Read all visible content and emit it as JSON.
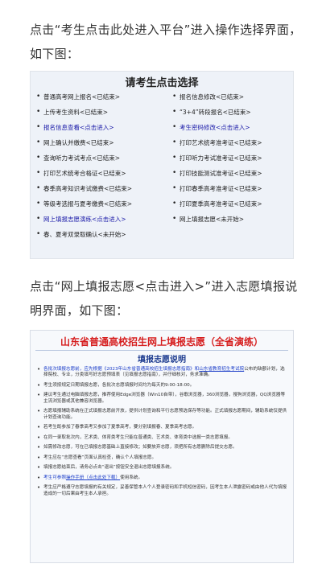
{
  "para1": "点击“考生点击此处进入平台”进入操作选择界面，如下图：",
  "panel1": {
    "title": "请考生点击选择",
    "left": [
      {
        "label": "普通高考网上报名<已结束>",
        "blue": false
      },
      {
        "label": "上传考生资料<已结束>",
        "blue": false
      },
      {
        "label": "报名信息查看<点击进入>",
        "blue": true
      },
      {
        "label": "网上确认并缴费<已结束>",
        "blue": false
      },
      {
        "label": "查询听力考试考点<已结束>",
        "blue": false
      },
      {
        "label": "打印艺术统考合格证<已结束>",
        "blue": false
      },
      {
        "label": "春季高考知识考试缴费<已结束>",
        "blue": false
      },
      {
        "label": "等级考选报与夏考缴费<已结束>",
        "blue": false
      },
      {
        "label": "网上填报志愿演练<点击进入>",
        "blue": true
      },
      {
        "label": "春、夏考双录取确认<未开始>",
        "blue": false
      }
    ],
    "right": [
      {
        "label": "报名信息修改<已结束>",
        "blue": false
      },
      {
        "label": "“3+4”转段报名<已结束>",
        "blue": false
      },
      {
        "label": "考生密码修改<点击进入>",
        "blue": true
      },
      {
        "label": "打印艺术统考准考证<已结束>",
        "blue": false
      },
      {
        "label": "打印听力考试准考证<已结束>",
        "blue": false
      },
      {
        "label": "打印技能测试准考证<已结束>",
        "blue": false
      },
      {
        "label": "打印春季高考准考证<已结束>",
        "blue": false
      },
      {
        "label": "打印夏季高考准考证<已结束>",
        "blue": false
      },
      {
        "label": "网上填报志愿<未开始>",
        "blue": false
      }
    ]
  },
  "para2": "点击“网上填报志愿<点击进入>”进入志愿填报说明界面，如下图：",
  "panel2": {
    "title": "山东省普通高校招生网上填报志愿（全省演练）",
    "subtitle": "填报志愿说明",
    "items": [
      {
        "a": "各批次填报志愿前，应先根据《2023年山东省普通高校招生填报志愿指南》和",
        "b": "山东省教育招生考试院",
        "c": "公布的缺额计划，选择院校、专业，分类填写好志愿预填表（见填报志愿指南），并仔细核对，务求准确。"
      },
      {
        "a": "",
        "b": "",
        "c": "考生须按规定日期填报志愿，各批次志愿填报时间均为每天的9:00-18:00。"
      },
      {
        "a": "",
        "b": "",
        "c": "建议考生通过电脑填报志愿，推荐使用Edge浏览器（Win10自带），谷歌浏览器，360浏览器，搜狗浏览器，QQ浏览器等主流浏览器或其他兼容浏览器。"
      },
      {
        "a": "",
        "b": "",
        "c": "志愿填报辅助系统在正式填报志愿前开放，提供计划查询和平行志愿预选保存等功能。正式填报志愿期间，辅助系统仅提供计划查询功能。"
      },
      {
        "a": "",
        "b": "",
        "c": "若考生既参加了春季高考又参加了夏季高考，要分别填报春、夏季高考志愿。"
      },
      {
        "a": "",
        "b": "",
        "c": "在同一录取批次内，艺术类、体育类考生只能在普通类、艺术类、体育类中选报一类志愿填报。"
      },
      {
        "a": "",
        "b": "",
        "c": "如需修改志愿，可在已填报志愿基础上直接修改；如要放弃志愿，须把所有志愿删除后提交志愿。"
      },
      {
        "a": "",
        "b": "",
        "c": "考生应在“志愿查看”页面认真检查，确认个人填报志愿。"
      },
      {
        "a": "",
        "b": "",
        "c": "填报志愿结束后，请务必点击“退出”按钮安全退出志愿填报系统。"
      },
      {
        "a": "考生可参照",
        "b": "操作手册（点击此处下载）",
        "c": "使用系统。"
      },
      {
        "a": "",
        "b": "",
        "c": "考生应严格遵守志愿填报的有关规定，妥善保管本人个人登录密码和手机短信密码，因考生本人泄露密码或由他人代为填报造成的一切后果由考生本人承担。"
      }
    ]
  }
}
